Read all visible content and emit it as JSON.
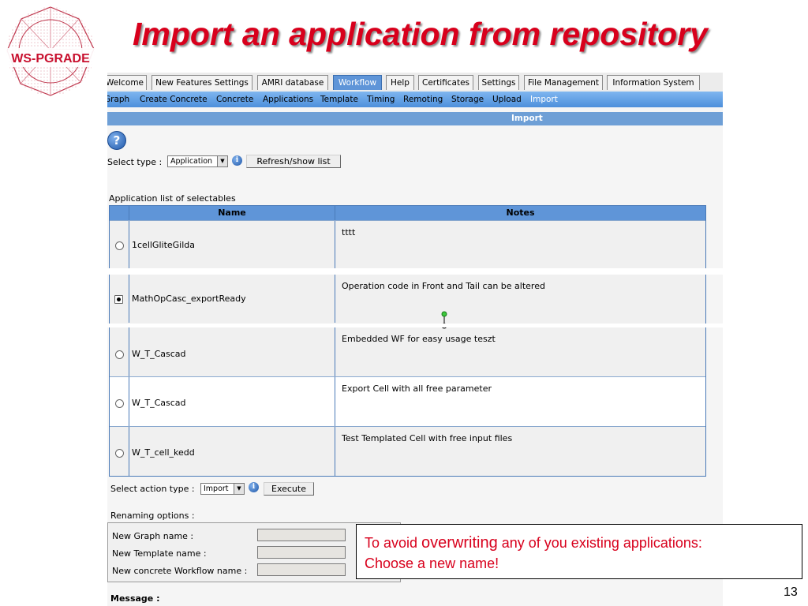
{
  "slide": {
    "title": "Import an application from repository",
    "logo_text": "WS-PGRADE",
    "page_number": "13"
  },
  "tabs": [
    {
      "label": "Welcome",
      "active": false
    },
    {
      "label": "New Features Settings",
      "active": false
    },
    {
      "label": "AMRI database",
      "active": false
    },
    {
      "label": "Workflow",
      "active": true
    },
    {
      "label": "Help",
      "active": false
    },
    {
      "label": "Certificates",
      "active": false
    },
    {
      "label": "Settings",
      "active": false
    },
    {
      "label": "File Management",
      "active": false
    },
    {
      "label": "Information System",
      "active": false
    }
  ],
  "subnav": [
    {
      "label": "Graph"
    },
    {
      "label": "Create Concrete"
    },
    {
      "label": "Concrete"
    },
    {
      "label": "Applications"
    },
    {
      "label": "Template"
    },
    {
      "label": "Timing"
    },
    {
      "label": "Remoting"
    },
    {
      "label": "Storage"
    },
    {
      "label": "Upload"
    },
    {
      "label": "Import",
      "current": true
    }
  ],
  "panel": {
    "header": "Import",
    "help_glyph": "?",
    "select_type_label": "Select type :",
    "select_type_value": "Application",
    "refresh_button": "Refresh/show list",
    "list_caption": "Application list of selectables",
    "info_glyph": "i"
  },
  "table": {
    "columns": [
      "Name",
      "Notes"
    ],
    "rows": [
      {
        "name": "1cellGliteGilda",
        "notes": "tttt",
        "selected": false
      },
      {
        "name": "MathOpCasc_exportReady",
        "notes": "Operation code in Front and Tail can be altered",
        "selected": true
      },
      {
        "name": "W_T_Cascad",
        "notes": "Embedded WF for easy usage teszt",
        "selected": false
      },
      {
        "name": "W_T_Cascad",
        "notes": "Export Cell with all free parameter",
        "selected": false
      },
      {
        "name": "W_T_cell_kedd",
        "notes": "Test Templated Cell with free input files",
        "selected": false
      }
    ]
  },
  "action": {
    "label": "Select action type :",
    "value": "Import",
    "execute_button": "Execute"
  },
  "renaming": {
    "title": "Renaming options :",
    "graph_label": "New Graph name :",
    "graph_value": "",
    "template_label": "New Template name :",
    "template_value": "",
    "workflow_label": "New concrete Workflow name :",
    "workflow_value": ""
  },
  "message_label": "Message :",
  "callout": {
    "prefix": "To avoid ",
    "emphasis": "overwriting",
    "rest": " any of you existing applications:",
    "line2": "Choose a new name!"
  },
  "colors": {
    "title_red": "#d8001c",
    "nav_blue": "#5f95d8",
    "header_blue": "#6e9fd6",
    "table_border": "#4a7ab8"
  }
}
